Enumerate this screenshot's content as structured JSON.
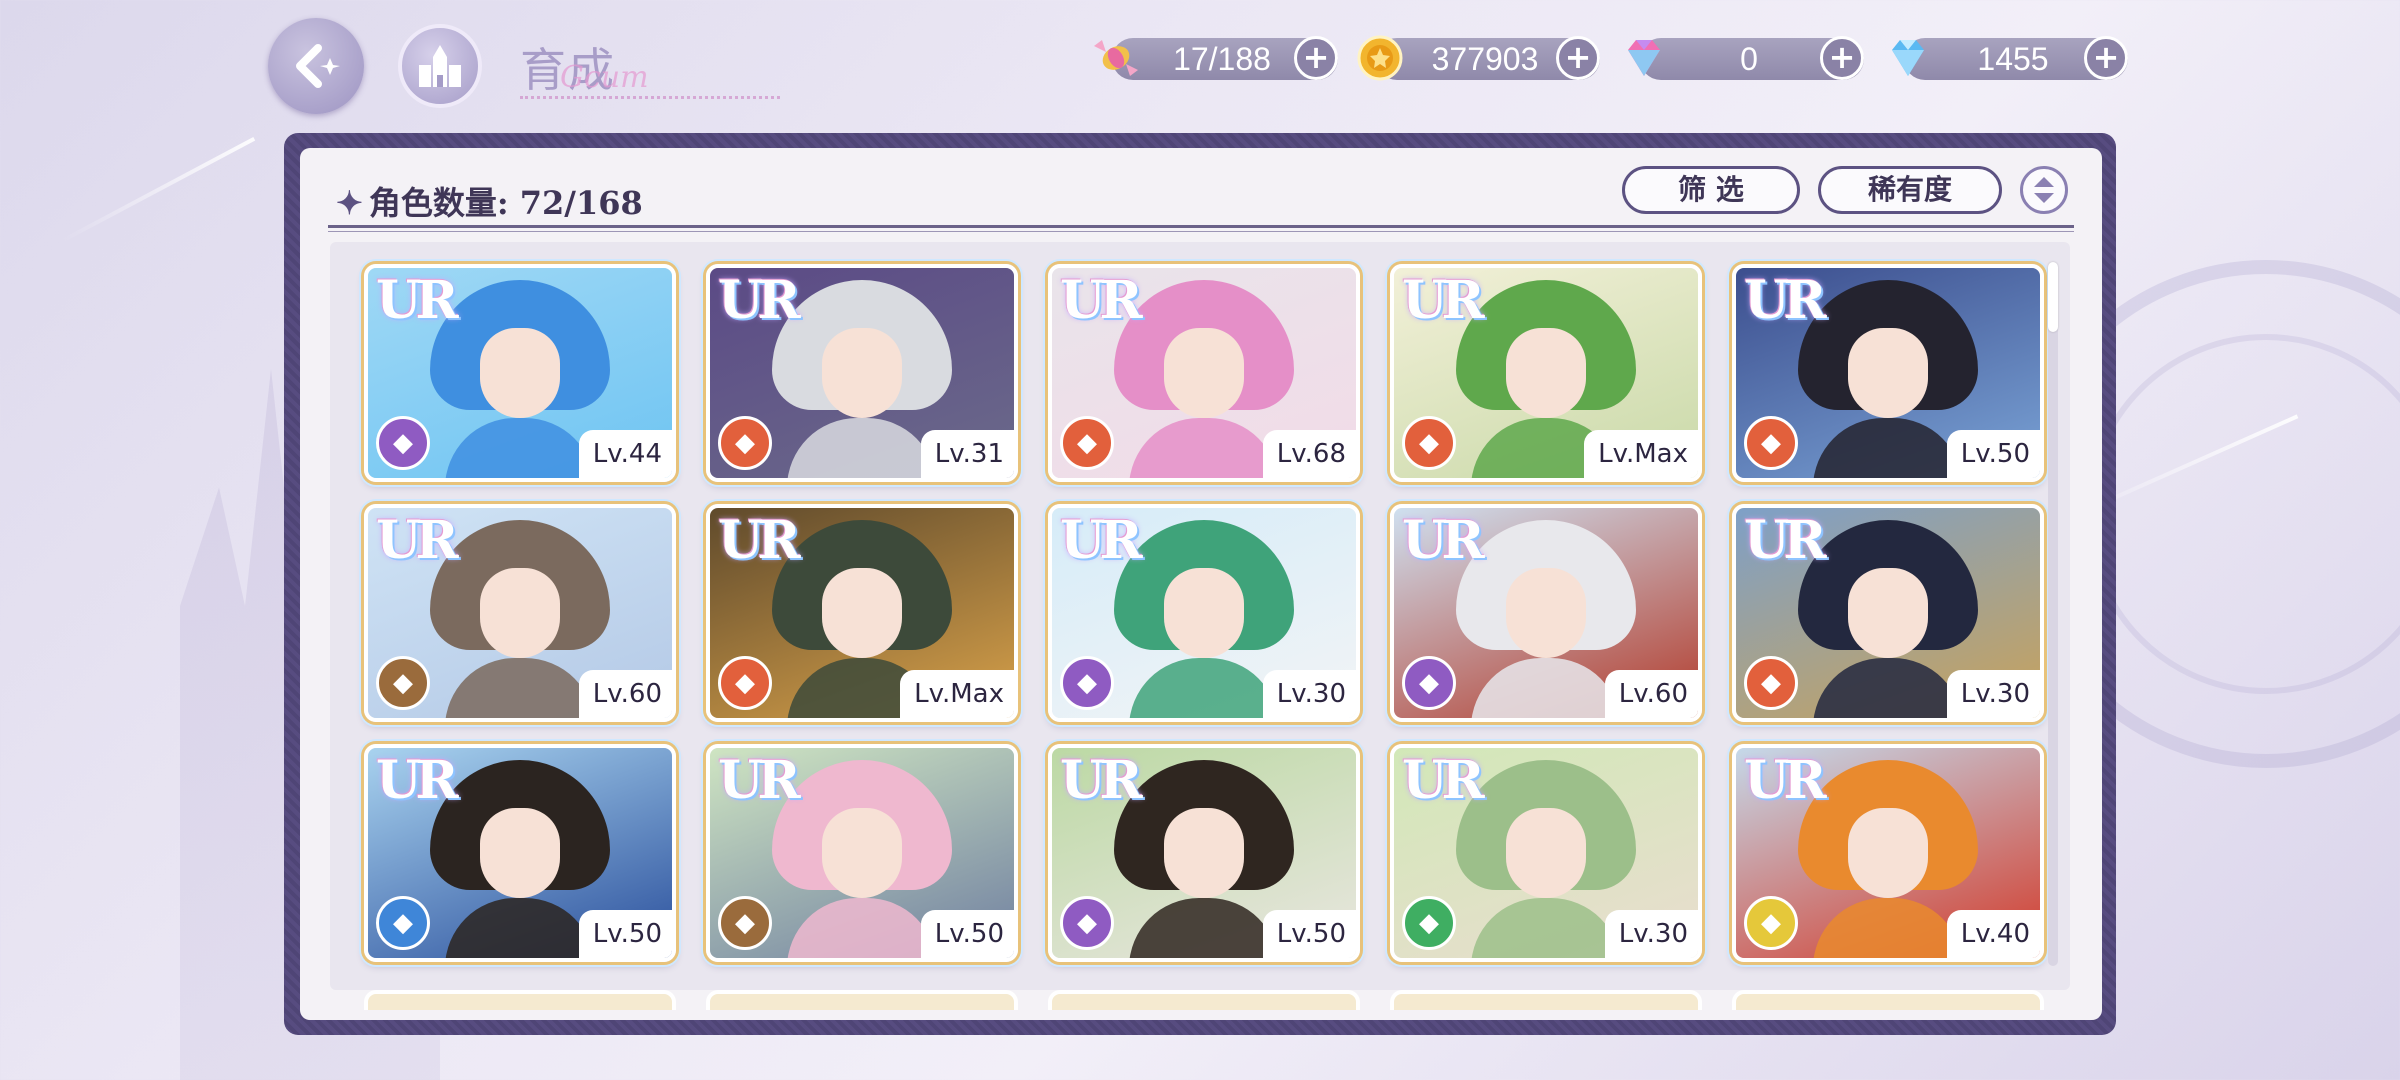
{
  "header": {
    "title": "育成",
    "title_script": "Gcum",
    "resources": [
      {
        "icon": "candy-icon",
        "value": "17/188"
      },
      {
        "icon": "gold-coin-icon",
        "value": "377903"
      },
      {
        "icon": "pink-gem-icon",
        "value": "0"
      },
      {
        "icon": "blue-diamond-icon",
        "value": "1455"
      }
    ]
  },
  "panel": {
    "count_label": "角色数量: 72/168",
    "filter_label": "筛 选",
    "rarity_label": "稀有度"
  },
  "cards": [
    {
      "rank": "UR",
      "level": "Lv.44",
      "role_color": "#8f5bc2",
      "art": [
        "#9fd8f5",
        "#3f8fe0",
        "#6ec4f2"
      ]
    },
    {
      "rank": "UR",
      "level": "Lv.31",
      "role_color": "#e2603c",
      "art": [
        "#5b4a86",
        "#d9dbe0",
        "#6b6a8a"
      ]
    },
    {
      "rank": "UR",
      "level": "Lv.68",
      "role_color": "#e2603c",
      "art": [
        "#e9e4ea",
        "#e58fc8",
        "#f2dbe8"
      ]
    },
    {
      "rank": "UR",
      "level": "Lv.Max",
      "role_color": "#e2603c",
      "art": [
        "#f2f0d8",
        "#5fa84c",
        "#c9d9a8"
      ]
    },
    {
      "rank": "UR",
      "level": "Lv.50",
      "role_color": "#e2603c",
      "art": [
        "#3c4e8e",
        "#24232f",
        "#7aa3d6"
      ]
    },
    {
      "rank": "UR",
      "level": "Lv.60",
      "role_color": "#9a6b3c",
      "art": [
        "#cfe3f5",
        "#7b6a5e",
        "#b4c9e6"
      ]
    },
    {
      "rank": "UR",
      "level": "Lv.Max",
      "role_color": "#e2603c",
      "art": [
        "#5f4a2c",
        "#3d4a3a",
        "#d9a24a"
      ]
    },
    {
      "rank": "UR",
      "level": "Lv.30",
      "role_color": "#8f5bc2",
      "art": [
        "#d6ecf8",
        "#3fa37a",
        "#f2f4f6"
      ]
    },
    {
      "rank": "UR",
      "level": "Lv.60",
      "role_color": "#8f5bc2",
      "art": [
        "#cfe0f0",
        "#e8e8ec",
        "#b23a2a"
      ]
    },
    {
      "rank": "UR",
      "level": "Lv.30",
      "role_color": "#e2603c",
      "art": [
        "#7ea0c8",
        "#23283f",
        "#c9a35a"
      ]
    },
    {
      "rank": "UR",
      "level": "Lv.50",
      "role_color": "#3f86d8",
      "art": [
        "#a9d3ef",
        "#2b2420",
        "#2a4f9c"
      ]
    },
    {
      "rank": "UR",
      "level": "Lv.50",
      "role_color": "#9a6b3c",
      "art": [
        "#cfe5c2",
        "#efb8cf",
        "#6f7fa0"
      ]
    },
    {
      "rank": "UR",
      "level": "Lv.50",
      "role_color": "#8f5bc2",
      "art": [
        "#bcd9a4",
        "#2f2620",
        "#e9e6e0"
      ]
    },
    {
      "rank": "UR",
      "level": "Lv.30",
      "role_color": "#3fae62",
      "art": [
        "#d2e8b8",
        "#9cbf8a",
        "#e9ddcf"
      ]
    },
    {
      "rank": "UR",
      "level": "Lv.40",
      "role_color": "#e5c83a",
      "art": [
        "#c5d9ea",
        "#e98a2e",
        "#d23a2a"
      ]
    }
  ]
}
